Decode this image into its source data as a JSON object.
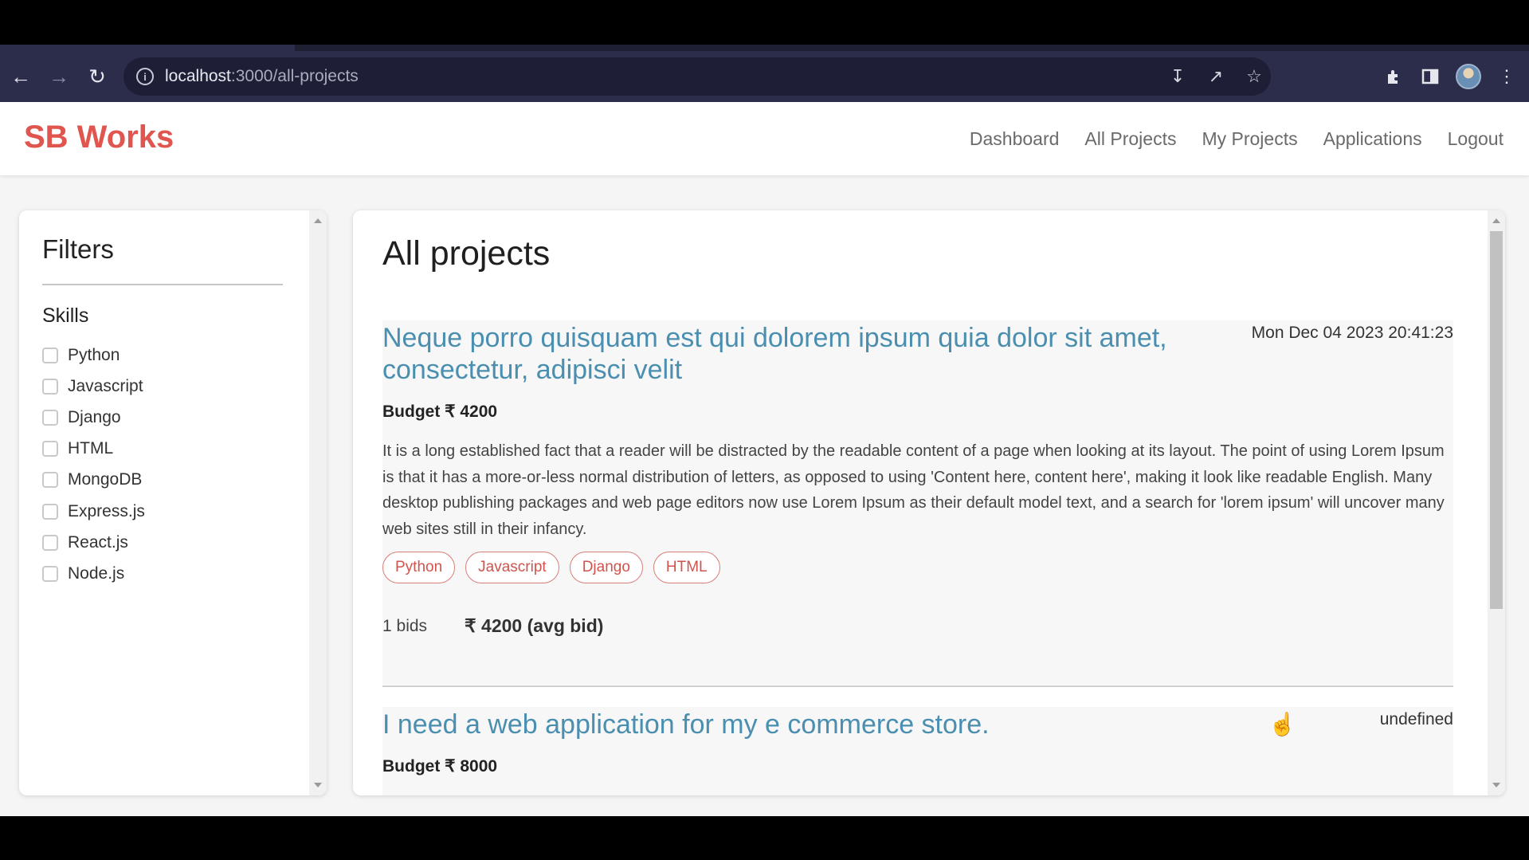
{
  "browser": {
    "url_host": "localhost",
    "url_path": ":3000/all-projects"
  },
  "app": {
    "brand": "SB Works",
    "nav": [
      "Dashboard",
      "All Projects",
      "My Projects",
      "Applications",
      "Logout"
    ]
  },
  "filters": {
    "title": "Filters",
    "skills_title": "Skills",
    "skills": [
      "Python",
      "Javascript",
      "Django",
      "HTML",
      "MongoDB",
      "Express.js",
      "React.js",
      "Node.js"
    ]
  },
  "main": {
    "title": "All projects",
    "projects": [
      {
        "title": "Neque porro quisquam est qui dolorem ipsum quia dolor sit amet, consectetur, adipisci velit",
        "date": "Mon Dec 04 2023 20:41:23",
        "budget": "Budget ₹ 4200",
        "description": "It is a long established fact that a reader will be distracted by the readable content of a page when looking at its layout. The point of using Lorem Ipsum is that it has a more-or-less normal distribution of letters, as opposed to using 'Content here, content here', making it look like readable English. Many desktop publishing packages and web page editors now use Lorem Ipsum as their default model text, and a search for 'lorem ipsum' will uncover many web sites still in their infancy.",
        "skills": [
          "Python",
          "Javascript",
          "Django",
          "HTML"
        ],
        "bids": "1 bids",
        "avg_bid": "₹ 4200 (avg bid)"
      },
      {
        "title": "I need a web application for my e commerce store.",
        "date": "undefined",
        "budget": "Budget ₹ 8000"
      }
    ]
  },
  "icons": {
    "back": "back-arrow-icon",
    "forward": "forward-arrow-icon",
    "reload": "reload-icon",
    "info": "info-icon",
    "install": "install-icon",
    "share": "share-icon",
    "bookmark": "star-icon",
    "extensions": "puzzle-icon",
    "sidepanel": "side-panel-icon",
    "menu": "kebab-menu-icon"
  }
}
